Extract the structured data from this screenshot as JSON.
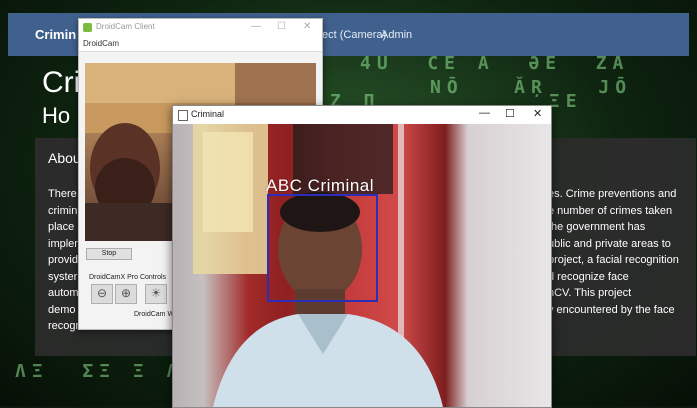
{
  "background_page": {
    "nav": {
      "brand": "Crimin",
      "links": [
        "ect (Camera)",
        "Admin"
      ]
    },
    "hero": {
      "title": "Cri",
      "subtitle": "Ho"
    },
    "about": {
      "heading": "Abou",
      "left_lines": [
        "There",
        "crimin",
        "place a",
        "implen",
        "provid",
        "syster",
        "autom",
        "demo"
      ],
      "left_last": "recognizer.",
      "right_lines": [
        "es. Crime preventions and",
        "e number of crimes taken",
        "the government has",
        "ublic and private areas to",
        "project, a facial recognition",
        "d recognize face",
        "nCV. This project",
        "y encountered by the face"
      ]
    }
  },
  "droidcam_window": {
    "title": "DroidCam Client",
    "menu": "DroidCam",
    "controls": {
      "minimize": "—",
      "maximize": "☐",
      "close": "✕"
    },
    "stop_label": "Stop",
    "pro_controls_label": "DroidCamX Pro Controls",
    "buttons": [
      {
        "icon": "zoom-out-icon",
        "glyph": "⊖"
      },
      {
        "icon": "zoom-in-icon",
        "glyph": "⊕"
      },
      {
        "icon": "brightness-icon",
        "glyph": "☀"
      }
    ],
    "footer": "DroidCam Wir"
  },
  "criminal_window": {
    "title": "Criminal",
    "controls": {
      "minimize": "—",
      "maximize": "☐",
      "close": "✕"
    },
    "detection_label": "ABC  Criminal",
    "box_color": "#2d2db8"
  },
  "colors": {
    "nav": "#40618d",
    "about_panel": "#2d2d2d",
    "matrix_green": "#8fe08f"
  }
}
